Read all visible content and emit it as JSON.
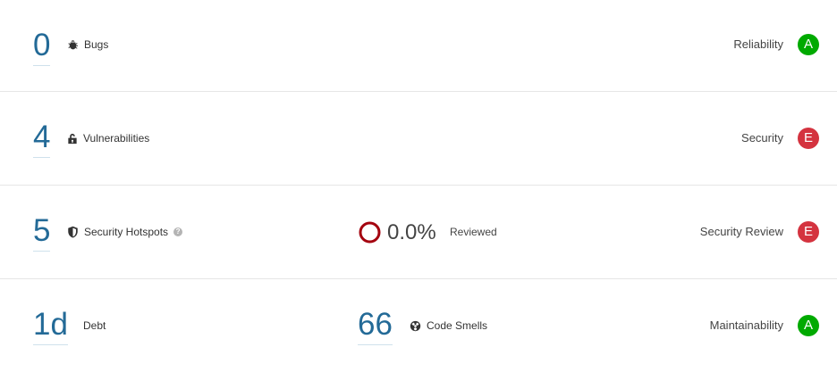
{
  "colors": {
    "link": "#236a97",
    "rating_a": "#00aa00",
    "rating_e": "#d4333f",
    "hotspot_ring": "#a4030f"
  },
  "reliability": {
    "count": "0",
    "label": "Bugs",
    "icon": "bug-icon",
    "rating_label": "Reliability",
    "rating": "A"
  },
  "security": {
    "count": "4",
    "label": "Vulnerabilities",
    "icon": "lock-icon",
    "rating_label": "Security",
    "rating": "E"
  },
  "hotspots": {
    "count": "5",
    "label": "Security Hotspots",
    "icon": "shield-icon",
    "help_icon": "question-circle-icon",
    "help_glyph": "?",
    "reviewed_percent": "0.0%",
    "reviewed_label": "Reviewed",
    "reviewed_fraction": 0.0,
    "rating_label": "Security Review",
    "rating": "E"
  },
  "maintainability": {
    "debt": "1d",
    "debt_label": "Debt",
    "smells_count": "66",
    "smells_label": "Code Smells",
    "smells_icon": "code-smell-icon",
    "rating_label": "Maintainability",
    "rating": "A"
  }
}
